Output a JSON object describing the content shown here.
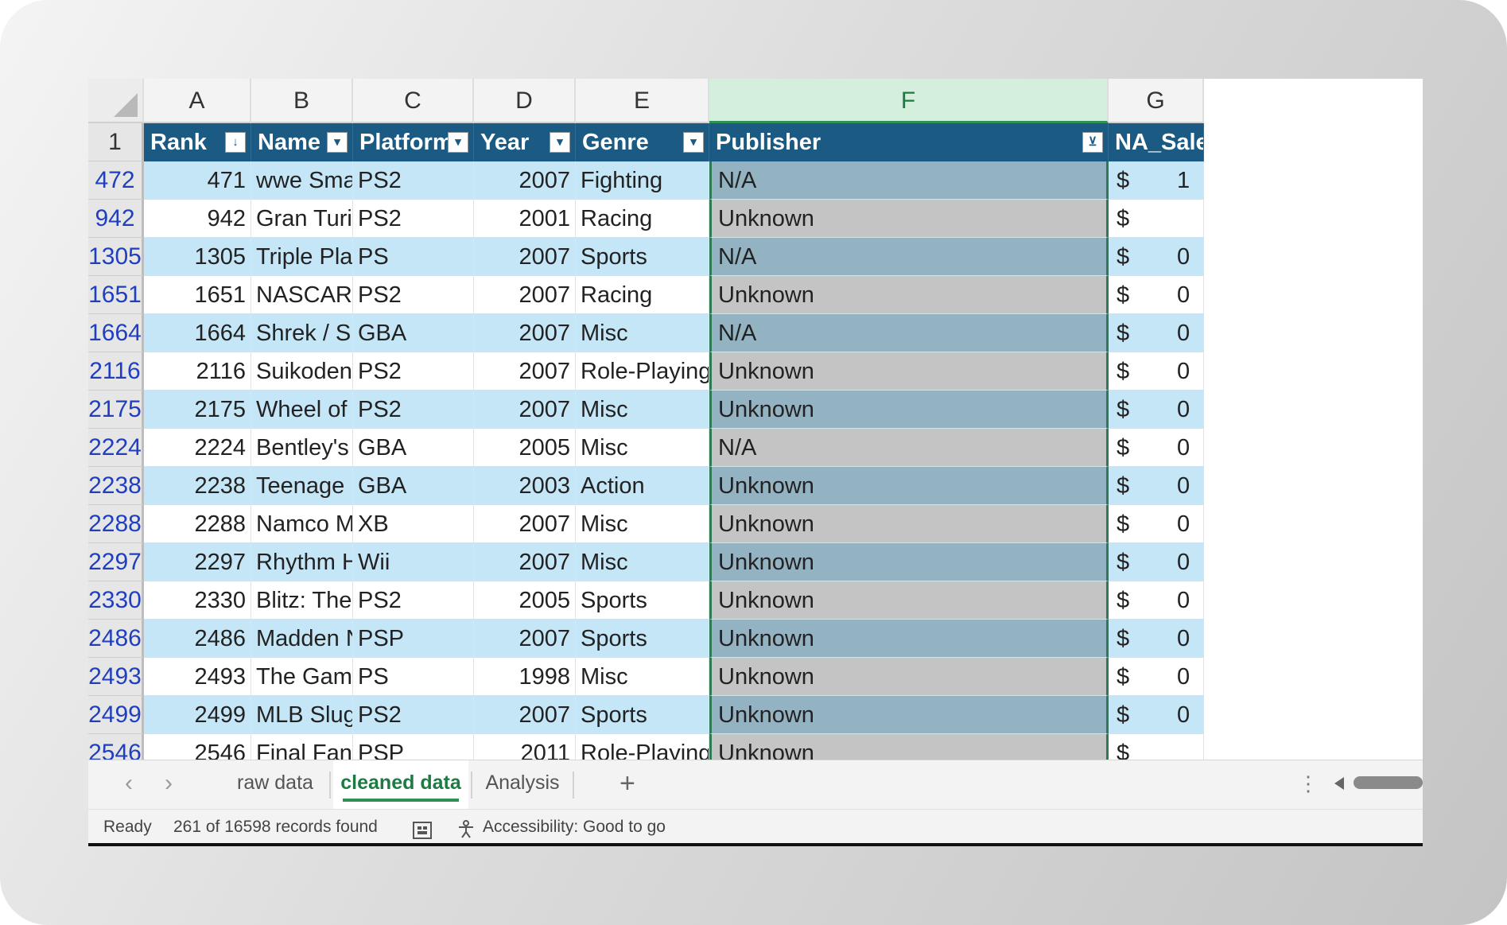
{
  "columns": {
    "letters": [
      "A",
      "B",
      "C",
      "D",
      "E",
      "F",
      "G"
    ],
    "selected": "F"
  },
  "header_row": {
    "row_number": "1",
    "fields": [
      "Rank",
      "Name",
      "Platform",
      "Year",
      "Genre",
      "Publisher",
      "NA_Sale"
    ]
  },
  "rows": [
    {
      "row": "472",
      "rank": "471",
      "name": "wwe Smac",
      "platform": "PS2",
      "year": "2007",
      "genre": "Fighting",
      "publisher": "N/A",
      "currency": "$",
      "na": "1"
    },
    {
      "row": "942",
      "rank": "942",
      "name": "Gran Turis",
      "platform": "PS2",
      "year": "2001",
      "genre": "Racing",
      "publisher": "Unknown",
      "currency": "$",
      "na": ""
    },
    {
      "row": "1305",
      "rank": "1305",
      "name": "Triple Play",
      "platform": "PS",
      "year": "2007",
      "genre": "Sports",
      "publisher": "N/A",
      "currency": "$",
      "na": "0"
    },
    {
      "row": "1651",
      "rank": "1651",
      "name": "NASCAR T",
      "platform": "PS2",
      "year": "2007",
      "genre": "Racing",
      "publisher": "Unknown",
      "currency": "$",
      "na": "0"
    },
    {
      "row": "1664",
      "rank": "1664",
      "name": "Shrek / Sh",
      "platform": "GBA",
      "year": "2007",
      "genre": "Misc",
      "publisher": "N/A",
      "currency": "$",
      "na": "0"
    },
    {
      "row": "2116",
      "rank": "2116",
      "name": "Suikoden I",
      "platform": "PS2",
      "year": "2007",
      "genre": "Role-Playing",
      "publisher": "Unknown",
      "currency": "$",
      "na": "0"
    },
    {
      "row": "2175",
      "rank": "2175",
      "name": "Wheel of F",
      "platform": "PS2",
      "year": "2007",
      "genre": "Misc",
      "publisher": "Unknown",
      "currency": "$",
      "na": "0"
    },
    {
      "row": "2224",
      "rank": "2224",
      "name": "Bentley's H",
      "platform": "GBA",
      "year": "2005",
      "genre": "Misc",
      "publisher": "N/A",
      "currency": "$",
      "na": "0"
    },
    {
      "row": "2238",
      "rank": "2238",
      "name": "Teenage M",
      "platform": "GBA",
      "year": "2003",
      "genre": "Action",
      "publisher": "Unknown",
      "currency": "$",
      "na": "0"
    },
    {
      "row": "2288",
      "rank": "2288",
      "name": "Namco Mu",
      "platform": "XB",
      "year": "2007",
      "genre": "Misc",
      "publisher": "Unknown",
      "currency": "$",
      "na": "0"
    },
    {
      "row": "2297",
      "rank": "2297",
      "name": "Rhythm He",
      "platform": "Wii",
      "year": "2007",
      "genre": "Misc",
      "publisher": "Unknown",
      "currency": "$",
      "na": "0"
    },
    {
      "row": "2330",
      "rank": "2330",
      "name": "Blitz: The L",
      "platform": "PS2",
      "year": "2005",
      "genre": "Sports",
      "publisher": "Unknown",
      "currency": "$",
      "na": "0"
    },
    {
      "row": "2486",
      "rank": "2486",
      "name": "Madden N",
      "platform": "PSP",
      "year": "2007",
      "genre": "Sports",
      "publisher": "Unknown",
      "currency": "$",
      "na": "0"
    },
    {
      "row": "2493",
      "rank": "2493",
      "name": "The Game",
      "platform": "PS",
      "year": "1998",
      "genre": "Misc",
      "publisher": "Unknown",
      "currency": "$",
      "na": "0"
    },
    {
      "row": "2499",
      "rank": "2499",
      "name": "MLB SlugF",
      "platform": "PS2",
      "year": "2007",
      "genre": "Sports",
      "publisher": "Unknown",
      "currency": "$",
      "na": "0"
    },
    {
      "row": "2546",
      "rank": "2546",
      "name": "Final Fant",
      "platform": "PSP",
      "year": "2011",
      "genre": "Role-Playing",
      "publisher": "Unknown",
      "currency": "$",
      "na": ""
    }
  ],
  "sheet_tabs": {
    "tabs": [
      "raw data",
      "cleaned data",
      "Analysis"
    ],
    "active": "cleaned data",
    "prev_icon": "‹",
    "next_icon": "›",
    "add_icon": "+",
    "more_icon": "⋮"
  },
  "status": {
    "ready": "Ready",
    "records": "261 of 16598 records found",
    "accessibility": "Accessibility: Good to go"
  },
  "icons": {
    "filter_icon": "filter-dropdown-icon",
    "active_filter_icon": "active-filter-icon",
    "accessibility_icon": "accessibility-icon",
    "macro_icon": "macro-recorder-icon"
  },
  "colors": {
    "header_fill": "#1b5a82",
    "band_fill": "#c5e6f7",
    "selected_column": "#1e7a43",
    "row_number_text": "#1f3fbf"
  }
}
